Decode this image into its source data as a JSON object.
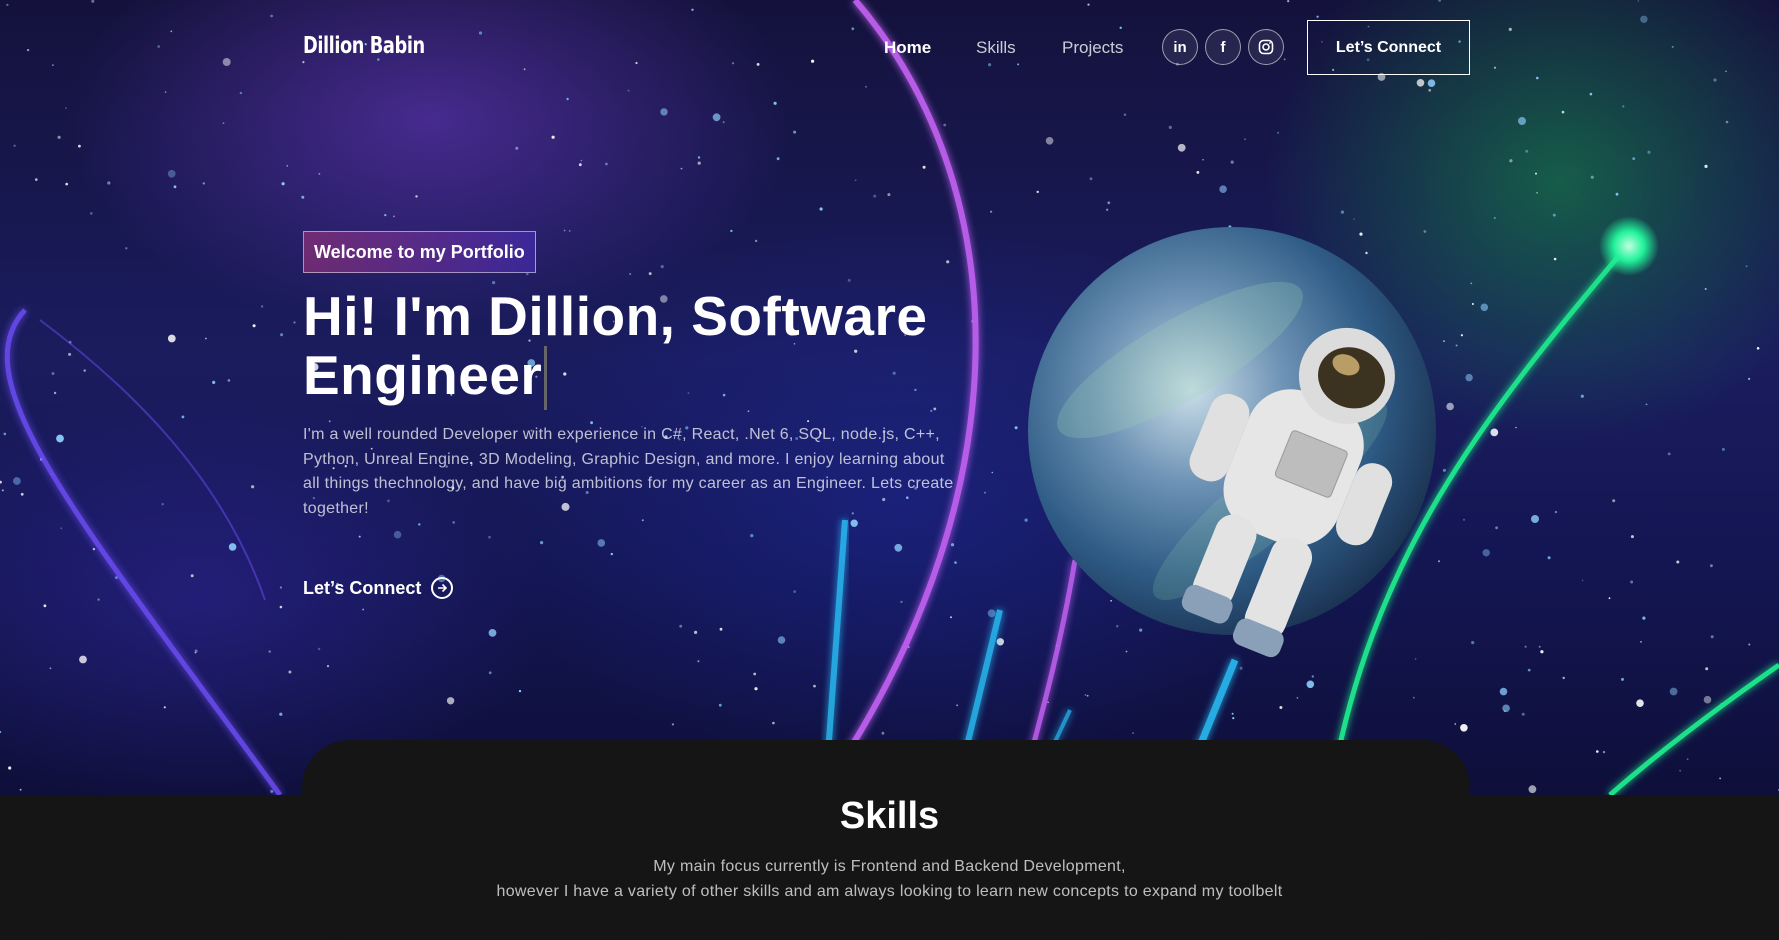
{
  "nav": {
    "logo": "Dillion Babin",
    "links": [
      "Home",
      "Skills",
      "Projects"
    ],
    "active": "Home",
    "social": [
      {
        "icon": "linkedin-icon",
        "glyph": "in"
      },
      {
        "icon": "facebook-icon",
        "glyph": "f"
      },
      {
        "icon": "instagram-icon",
        "glyph": ""
      }
    ],
    "connect_label": "Let’s Connect"
  },
  "hero": {
    "tagline": "Welcome to my Portfolio",
    "headline": "Hi! I'm Dillion, Software Engineer",
    "intro": "I'm a well rounded Developer with experience in C#, React, .Net 6, SQL, node.js, C++, Python, Unreal Engine, 3D Modeling, Graphic Design, and more. I enjoy learning about all things thechnology, and have big ambitions for my career as an Engineer. Lets create together!",
    "connect_label": "Let’s Connect",
    "illustration": "astronaut-planet"
  },
  "skills": {
    "title": "Skills",
    "description_line1": "My main focus currently is Frontend and Backend Development,",
    "description_line2": "however I have a variety of other skills and am always looking to learn new concepts to expand my toolbelt"
  },
  "colors": {
    "accent_gradient_start": "#aa367c",
    "accent_gradient_end": "#4a2fbd",
    "dark_bg": "#151515",
    "neon_purple": "#c061f0",
    "neon_green": "#1fe08a",
    "neon_cyan": "#2cc8ff"
  }
}
